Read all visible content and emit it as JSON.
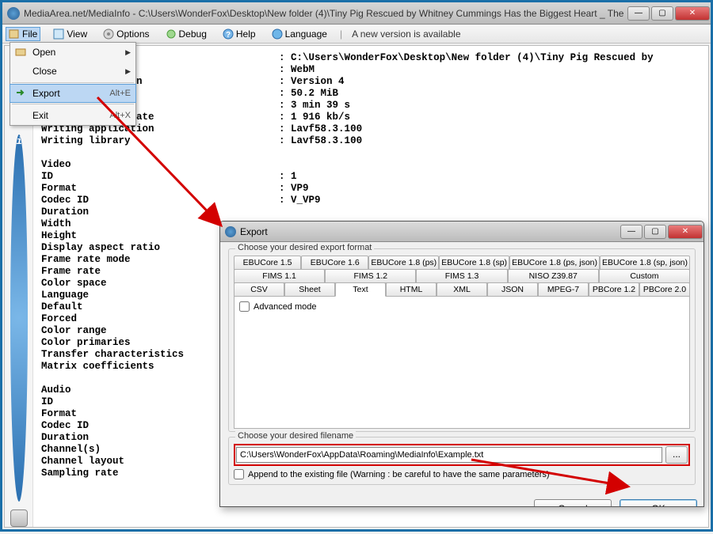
{
  "window": {
    "title": "MediaArea.net/MediaInfo - C:\\Users\\WonderFox\\Desktop\\New folder (4)\\Tiny Pig Rescued by Whitney Cummings Has the Biggest Heart _ The ..."
  },
  "menubar": {
    "file": "File",
    "view": "View",
    "options": "Options",
    "debug": "Debug",
    "help": "Help",
    "language": "Language",
    "notice": "A new version is available"
  },
  "file_menu": {
    "open": "Open",
    "close_menu": "Close",
    "export": "Export",
    "export_key": "Alt+E",
    "exit": "Exit",
    "exit_key": "Alt+X"
  },
  "info_text": "             ame                        : C:\\Users\\WonderFox\\Desktop\\New folder (4)\\Tiny Pig Rescued by\n                                        : WebM\n             sion                       : Version 4\n                                        : 50.2 MiB\n                                        : 3 min 39 s\n             t rate                     : 1 916 kb/s\nWriting application                     : Lavf58.3.100\nWriting library                         : Lavf58.3.100\n\nVideo\nID                                      : 1\nFormat                                  : VP9\nCodec ID                                : V_VP9\nDuration\nWidth\nHeight\nDisplay aspect ratio\nFrame rate mode\nFrame rate\nColor space\nLanguage\nDefault\nForced\nColor range\nColor primaries\nTransfer characteristics\nMatrix coefficients\n\nAudio\nID\nFormat\nCodec ID\nDuration\nChannel(s)\nChannel layout\nSampling rate",
  "dialog": {
    "title": "Export",
    "group_format": "Choose your desired export format",
    "tabs_row1": [
      "EBUCore 1.5",
      "EBUCore 1.6",
      "EBUCore 1.8 (ps)",
      "EBUCore 1.8 (sp)",
      "EBUCore 1.8 (ps, json)",
      "EBUCore 1.8 (sp, json)"
    ],
    "tabs_row2": [
      "FIMS 1.1",
      "FIMS 1.2",
      "FIMS 1.3",
      "NISO Z39.87",
      "Custom"
    ],
    "tabs_row3": [
      "CSV",
      "Sheet",
      "Text",
      "HTML",
      "XML",
      "JSON",
      "MPEG-7",
      "PBCore 1.2",
      "PBCore 2.0"
    ],
    "active_tab": "Text",
    "advanced": "Advanced mode",
    "group_filename": "Choose your desired filename",
    "filename": "C:\\Users\\WonderFox\\AppData\\Roaming\\MediaInfo\\Example.txt",
    "append": "Append to the existing file (Warning : be careful to have the same parameters)",
    "cancel": "Cancel",
    "ok": "OK"
  }
}
